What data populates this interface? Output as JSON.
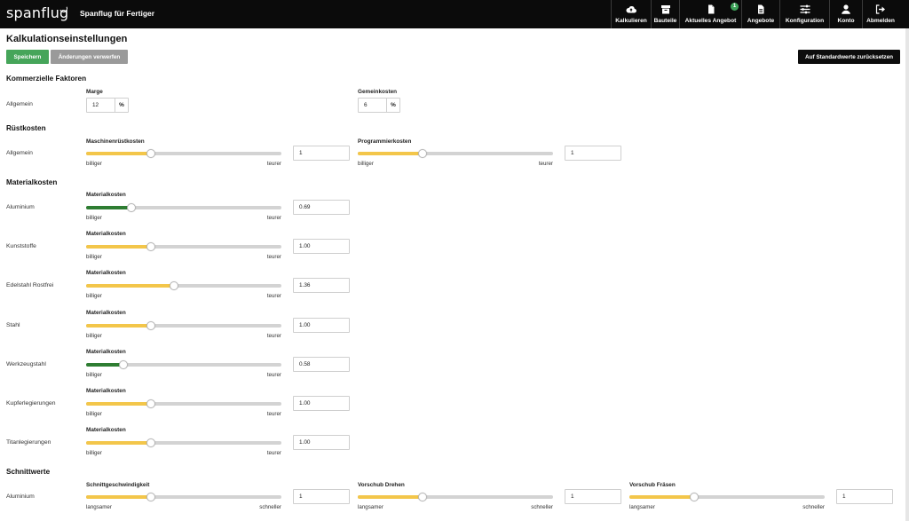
{
  "header": {
    "logo_text": "spanflug",
    "app_title": "Spanflug für Fertiger",
    "nav": [
      {
        "label": "Kalkulieren",
        "icon": "cloud-upload-icon"
      },
      {
        "label": "Bauteile",
        "icon": "archive-box-icon"
      },
      {
        "label": "Aktuelles Angebot",
        "icon": "document-icon",
        "badge": "1"
      },
      {
        "label": "Angebote",
        "icon": "document-lines-icon"
      },
      {
        "label": "Konfiguration",
        "icon": "sliders-icon"
      },
      {
        "label": "Konto",
        "icon": "user-icon"
      },
      {
        "label": "Abmelden",
        "icon": "sign-out-icon"
      }
    ]
  },
  "page": {
    "title": "Kalkulationseinstellungen",
    "save_label": "Speichern",
    "discard_label": "Änderungen verwerfen",
    "reset_label": "Auf Standardwerte zurücksetzen"
  },
  "commercial": {
    "title": "Kommerzielle Faktoren",
    "row_label": "Allgemein",
    "margin": {
      "label": "Marge",
      "value": "12",
      "unit": "%"
    },
    "overhead": {
      "label": "Gemeinkosten",
      "value": "6",
      "unit": "%"
    }
  },
  "setup": {
    "title": "Rüstkosten",
    "row_label": "Allgemein",
    "machine": {
      "label": "Maschinenrüstkosten",
      "value": "1",
      "low": "billiger",
      "high": "teurer",
      "level": 0.33,
      "fill": "yellow"
    },
    "programming": {
      "label": "Programmierkosten",
      "value": "1",
      "low": "billiger",
      "high": "teurer",
      "level": 0.33,
      "fill": "yellow"
    }
  },
  "material": {
    "title": "Materialkosten",
    "rows": [
      {
        "material": "Aluminium",
        "label": "Materialkosten",
        "value": "0.69",
        "low": "billiger",
        "high": "teurer",
        "level": 0.23,
        "fill": "green"
      },
      {
        "material": "Kunststoffe",
        "label": "Materialkosten",
        "value": "1.00",
        "low": "billiger",
        "high": "teurer",
        "level": 0.33,
        "fill": "yellow"
      },
      {
        "material": "Edelstahl Rostfrei",
        "label": "Materialkosten",
        "value": "1.36",
        "low": "billiger",
        "high": "teurer",
        "level": 0.45,
        "fill": "yellow"
      },
      {
        "material": "Stahl",
        "label": "Materialkosten",
        "value": "1.00",
        "low": "billiger",
        "high": "teurer",
        "level": 0.33,
        "fill": "yellow"
      },
      {
        "material": "Werkzeugstahl",
        "label": "Materialkosten",
        "value": "0.58",
        "low": "billiger",
        "high": "teurer",
        "level": 0.19,
        "fill": "green"
      },
      {
        "material": "Kupferlegierungen",
        "label": "Materialkosten",
        "value": "1.00",
        "low": "billiger",
        "high": "teurer",
        "level": 0.33,
        "fill": "yellow"
      },
      {
        "material": "Titanlegierungen",
        "label": "Materialkosten",
        "value": "1.00",
        "low": "billiger",
        "high": "teurer",
        "level": 0.33,
        "fill": "yellow"
      }
    ]
  },
  "cutting": {
    "title": "Schnittwerte",
    "row_label": "Aluminium",
    "fields": [
      {
        "label": "Schnittgeschwindigkeit",
        "value": "1",
        "low": "langsamer",
        "high": "schneller",
        "level": 0.33,
        "fill": "yellow"
      },
      {
        "label": "Vorschub Drehen",
        "value": "1",
        "low": "langsamer",
        "high": "schneller",
        "level": 0.33,
        "fill": "yellow"
      },
      {
        "label": "Vorschub Fräsen",
        "value": "1",
        "low": "langsamer",
        "high": "schneller",
        "level": 0.33,
        "fill": "yellow"
      }
    ]
  }
}
